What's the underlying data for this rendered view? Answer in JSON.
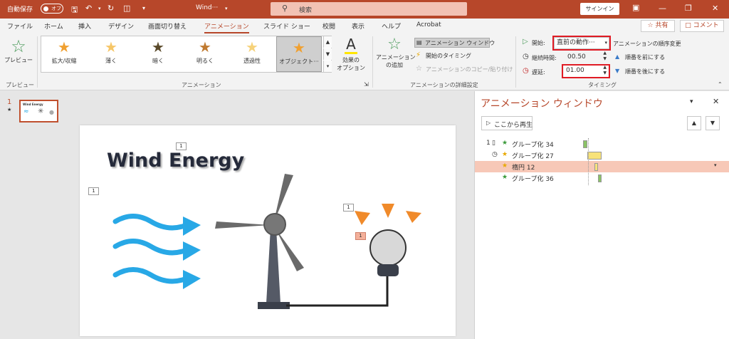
{
  "titlebar": {
    "autosave": "自動保存",
    "autosave_state": "オフ",
    "doc_title": "Wind···",
    "search_placeholder": "検索",
    "signin": "サインイン"
  },
  "tabs": [
    "ファイル",
    "ホーム",
    "挿入",
    "デザイン",
    "画面切り替え",
    "アニメーション",
    "スライド ショー",
    "校閲",
    "表示",
    "ヘルプ",
    "Acrobat"
  ],
  "share": "共有",
  "comment": "コメント",
  "ribbon": {
    "preview": "プレビュー",
    "preview_group": "プレビュー",
    "animations": [
      {
        "label": "拡大/収縮",
        "color": "#f0a030"
      },
      {
        "label": "薄く",
        "color": "#f6c667"
      },
      {
        "label": "暗く",
        "color": "#5a4a2a"
      },
      {
        "label": "明るく",
        "color": "#c07a30"
      },
      {
        "label": "透過性",
        "color": "#f6d27a"
      },
      {
        "label": "オブジェクト···",
        "color": "#f0a030"
      }
    ],
    "effect_options": "効果の\nオプション",
    "animation_group": "アニメーション",
    "add_animation": "アニメーション\nの追加",
    "anim_pane_btn": "アニメーション ウィンドウ",
    "trigger": "開始のタイミング",
    "painter": "アニメーションのコピー/貼り付け",
    "advanced_group": "アニメーションの詳細設定",
    "start_label": "開始:",
    "start_value": "直前の動作···",
    "duration_label": "継続時間:",
    "duration_value": "00.50",
    "delay_label": "遅延:",
    "delay_value": "01.00",
    "reorder_title": "アニメーションの順序変更",
    "move_earlier": "順番を前にする",
    "move_later": "順番を後にする",
    "timing_group": "タイミング"
  },
  "slides": {
    "number": "1",
    "thumb_title": "Wind Energy"
  },
  "slide": {
    "title": "Wind Energy",
    "tags": [
      "1",
      "1",
      "1",
      "1"
    ]
  },
  "anim_pane": {
    "title": "アニメーション ウィンドウ",
    "play_button": "ここから再生",
    "rows": [
      {
        "num": "1",
        "name": "グループ化 34",
        "bar_color": "#8ac265"
      },
      {
        "num": "",
        "name": "グループ化 27",
        "bar_color": "#f7e27a"
      },
      {
        "num": "",
        "name": "楕円 12",
        "bar_color": "#f7e27a"
      },
      {
        "num": "",
        "name": "グループ化 36",
        "bar_color": "#8ac265"
      }
    ]
  }
}
